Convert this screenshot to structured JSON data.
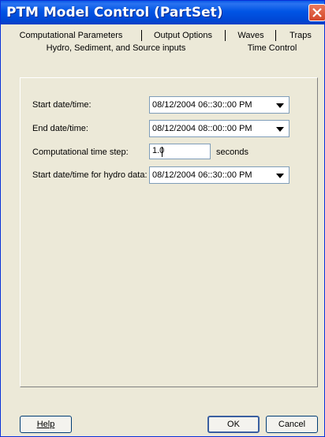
{
  "window": {
    "title": "PTM Model Control (PartSet)"
  },
  "tabs_row1": [
    {
      "label": "Computational Parameters"
    },
    {
      "label": "Output Options"
    },
    {
      "label": "Waves"
    },
    {
      "label": "Traps"
    }
  ],
  "tabs_row2": [
    {
      "label": "Hydro, Sediment, and Source inputs"
    },
    {
      "label": "Time Control",
      "selected": true
    }
  ],
  "form": {
    "start_label": "Start date/time:",
    "start_value": "08/12/2004  06::30::00 PM",
    "end_label": "End date/time:",
    "end_value": "08/12/2004  08::00::00 PM",
    "timestep_label": "Computational time step:",
    "timestep_value": "1.0",
    "timestep_units": "seconds",
    "hydro_label": "Start date/time for hydro data:",
    "hydro_value": "08/12/2004  06::30::00 PM"
  },
  "buttons": {
    "help_label": "Help",
    "ok_label": "OK",
    "cancel_label": "Cancel"
  },
  "icons": {
    "close": "close-icon",
    "dropdown": "chevron-down-icon"
  }
}
